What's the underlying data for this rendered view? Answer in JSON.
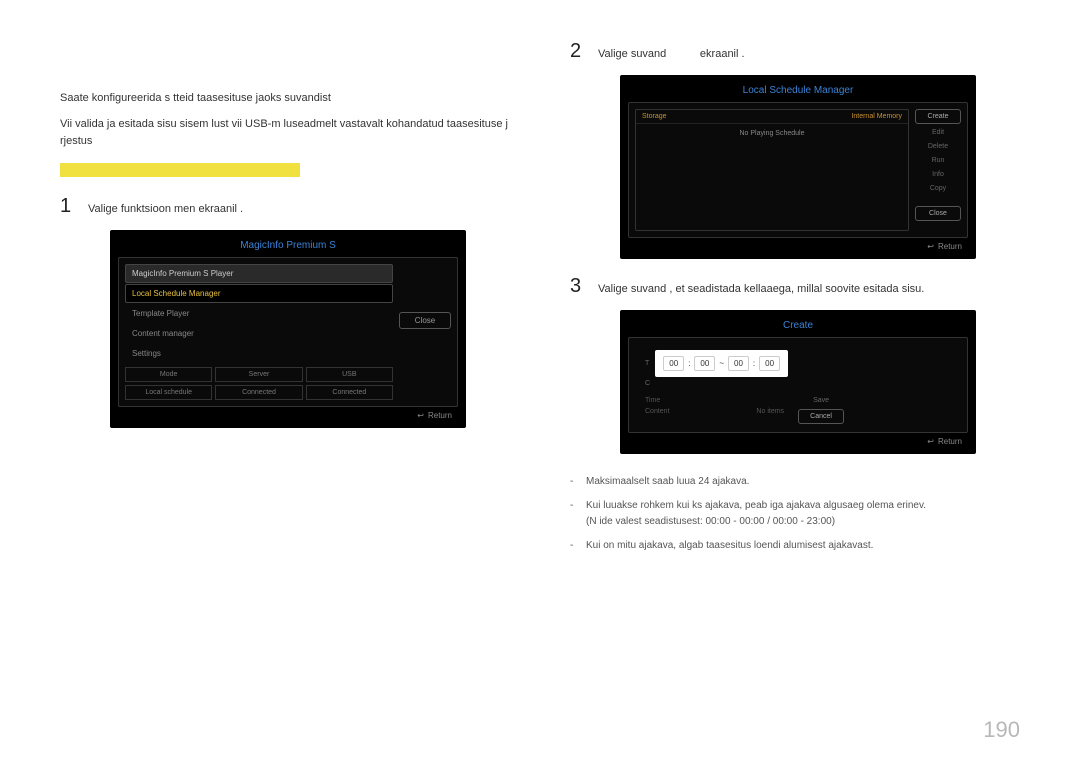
{
  "intro": {
    "line1": "Saate konfigureerida s tteid taasesituse jaoks suvandist",
    "line2": "Vii valida ja esitada sisu sisem lust vii USB-m luseadmelt vastavalt kohandatud taasesituse j rjestus"
  },
  "steps": {
    "s1": {
      "num": "1",
      "text": "Valige funktsioon  men  ekraanil ."
    },
    "s2": {
      "num": "2",
      "text_a": "Valige suvand",
      "text_b": "ekraanil ."
    },
    "s3": {
      "num": "3",
      "text": "Valige suvand , et seadistada kellaaega, millal soovite esitada sisu."
    }
  },
  "magicinfo": {
    "title": "MagicInfo Premium S",
    "items": {
      "player": "MagicInfo Premium S Player",
      "lsm": "Local Schedule Manager",
      "template": "Template Player",
      "content": "Content manager",
      "settings": "Settings"
    },
    "close": "Close",
    "grid": {
      "mode": "Mode",
      "server": "Server",
      "usb": "USB",
      "local": "Local schedule",
      "connected1": "Connected",
      "connected2": "Connected"
    },
    "return": "Return"
  },
  "lsm": {
    "title": "Local Schedule Manager",
    "storage": "Storage",
    "internal": "Internal Memory",
    "noplaying": "No Playing Schedule",
    "buttons": {
      "create": "Create",
      "edit": "Edit",
      "delete": "Delete",
      "run": "Run",
      "info": "Info",
      "copy": "Copy",
      "close": "Close"
    },
    "return": "Return"
  },
  "create": {
    "title": "Create",
    "t_label": "T",
    "c_label": "C",
    "time": {
      "h1": "00",
      "m1": "00",
      "h2": "00",
      "m2": "00",
      "tilde": "~",
      "colon": ":"
    },
    "rows": {
      "time": "Time",
      "content": "Content",
      "noitems": "No items"
    },
    "buttons": {
      "save": "Save",
      "cancel": "Cancel"
    },
    "return": "Return"
  },
  "notes": {
    "n1": "Maksimaalselt saab luua 24 ajakava.",
    "n2a": "Kui luuakse rohkem kui  ks ajakava, peab iga ajakava algusaeg olema erinev.",
    "n2b": "(N ide valest seadistusest: 00:00 - 00:00 / 00:00 - 23:00)",
    "n3": "Kui on mitu ajakava, algab taasesitus loendi alumisest ajakavast."
  },
  "page_number": "190"
}
